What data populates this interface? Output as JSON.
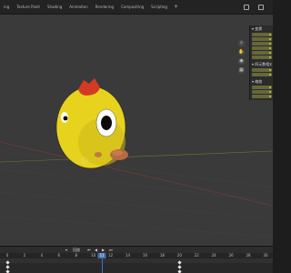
{
  "workspace_tabs": [
    {
      "label": "ing",
      "active": false
    },
    {
      "label": "Texture Paint",
      "active": false
    },
    {
      "label": "Shading",
      "active": false
    },
    {
      "label": "Animation",
      "active": false
    },
    {
      "label": "Rendering",
      "active": false
    },
    {
      "label": "Compositing",
      "active": false
    },
    {
      "label": "Scripting",
      "active": false
    }
  ],
  "add_tab_label": "+",
  "viewport": {
    "overlay_icons": [
      "zoom-icon",
      "hand-pan-icon",
      "camera-icon",
      "grid-view-icon"
    ]
  },
  "npanel": {
    "sections": [
      {
        "title": "▾ 变换",
        "fields": 6
      },
      {
        "title": "▾ 四元数相对",
        "fields": 2
      },
      {
        "title": "▾ 缩放",
        "fields": 3
      }
    ]
  },
  "timeline": {
    "playback_label": "回放",
    "current_frame": "11",
    "ticks": [
      "0",
      "2",
      "4",
      "6",
      "8",
      "10",
      "12",
      "14",
      "16",
      "18",
      "20",
      "22",
      "24",
      "26",
      "28",
      "30"
    ],
    "colors": {
      "playhead": "#4772b3",
      "keyframe": "#e6e6e6"
    }
  },
  "scene": {
    "body_color": "#e7d21d",
    "comb_color": "#d23b22",
    "beak_color": "#b86a43",
    "axis_x_color": "#8a3a3a",
    "axis_y_color": "#5c7f2d"
  }
}
